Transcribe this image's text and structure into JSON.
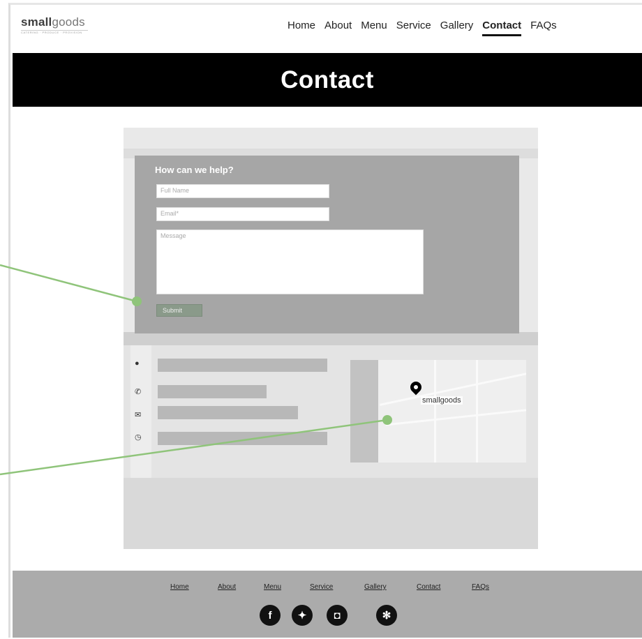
{
  "logo": {
    "bold": "small",
    "light": "goods",
    "tagline": "CATERING · PRODUCE · PROVISION"
  },
  "nav": {
    "items": [
      "Home",
      "About",
      "Menu",
      "Service",
      "Gallery",
      "Contact",
      "FAQs"
    ],
    "active": "Contact"
  },
  "banner": {
    "title": "Contact"
  },
  "form": {
    "title": "How can we help?",
    "name_placeholder": "Full Name",
    "email_placeholder": "Email*",
    "message_placeholder": "Message",
    "submit_label": "Submit"
  },
  "map": {
    "brand": "smallgoods"
  },
  "footer": {
    "links": [
      "Home",
      "About",
      "Menu",
      "Service",
      "Gallery",
      "Contact",
      "FAQs"
    ]
  },
  "social": [
    "facebook-icon",
    "twitter-icon",
    "instagram-icon",
    "yelp-icon"
  ],
  "colors": {
    "banner": "#000000",
    "footer": "#ababab",
    "annotation": "#8fc47a",
    "submit": "#8a9a8a"
  }
}
